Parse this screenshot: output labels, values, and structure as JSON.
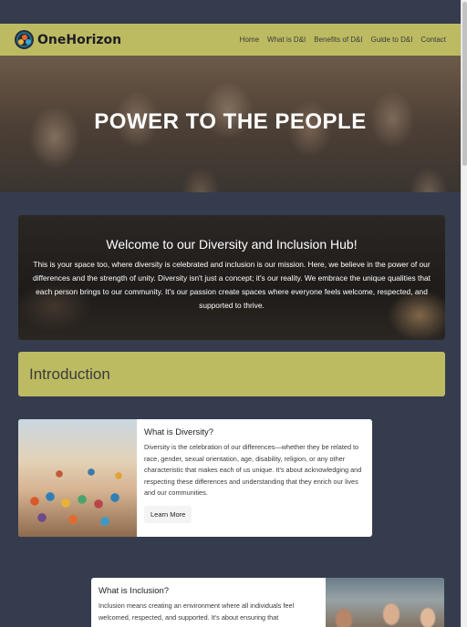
{
  "brand": {
    "name": "OneHorizon"
  },
  "nav": [
    "Home",
    "What is D&I",
    "Benefits of D&I",
    "Guide to D&I",
    "Contact"
  ],
  "hero": {
    "title": "POWER TO THE PEOPLE"
  },
  "welcome": {
    "title": "Welcome to our Diversity and Inclusion Hub!",
    "text": "This is your space too, where diversity is celebrated and inclusion is our mission. Here, we believe in the power of our differences and the strength of unity. Diversity isn't just a concept; it's our reality. We embrace the unique qualities that each person brings to our community. It's our passion create spaces where everyone feels welcome, respected, and supported to thrive."
  },
  "intro": {
    "title": "Introduction"
  },
  "cards": [
    {
      "title": "What is Diversity?",
      "text": "Diversity is the celebration of our differences—whether they be related to race, gender, sexual orientation, age, disability, religion, or any other characteristic that makes each of us unique. It's about acknowledging and respecting these differences and understanding that they enrich our lives and our communities.",
      "button": "Learn More"
    },
    {
      "title": "What is Inclusion?",
      "text": "Inclusion means creating an environment where all individuals feel welcomed, respected, and supported. It's about ensuring that"
    }
  ],
  "colors": {
    "accent": "#bdbb62",
    "background": "#353c4e"
  },
  "icons": {
    "logo": "globe-people-icon"
  }
}
